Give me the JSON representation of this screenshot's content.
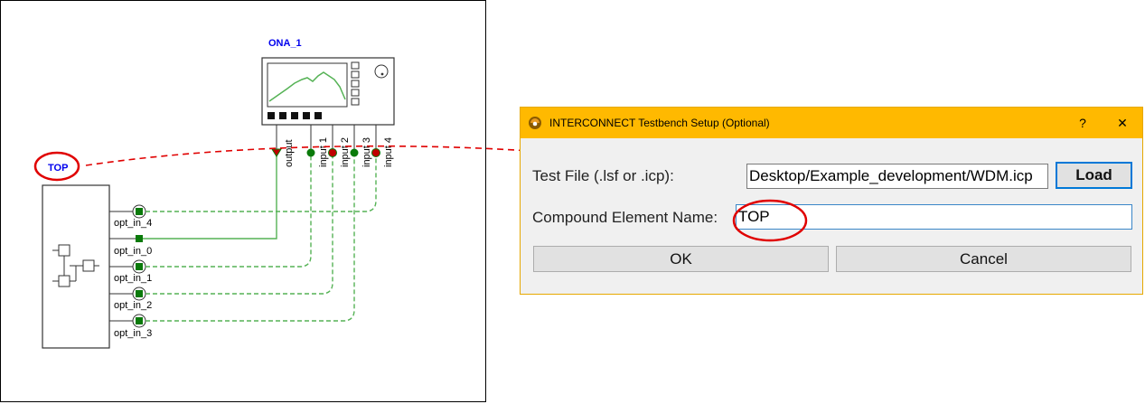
{
  "schematic": {
    "ona_label": "ONA_1",
    "ona_ports": [
      "output",
      "input 1",
      "input 2",
      "input 3",
      "input 4"
    ],
    "compound_label": "TOP",
    "compound_ports": [
      "opt_in_4",
      "opt_in_0",
      "opt_in_1",
      "opt_in_2",
      "opt_in_3"
    ]
  },
  "dialog": {
    "title": "INTERCONNECT Testbench Setup (Optional)",
    "help_label": "?",
    "close_label": "✕",
    "test_file_label": "Test File (.lsf or .icp):",
    "test_file_value": "Desktop/Example_development/WDM.icp",
    "load_label": "Load",
    "compound_name_label": "Compound Element Name:",
    "compound_name_value": "TOP",
    "ok_label": "OK",
    "cancel_label": "Cancel"
  },
  "colors": {
    "titlebar": "#ffb900",
    "annotation_red": "#e00000",
    "wire_green": "#55b255",
    "port_green": "#0a7a0a",
    "label_blue": "#0000ee"
  }
}
